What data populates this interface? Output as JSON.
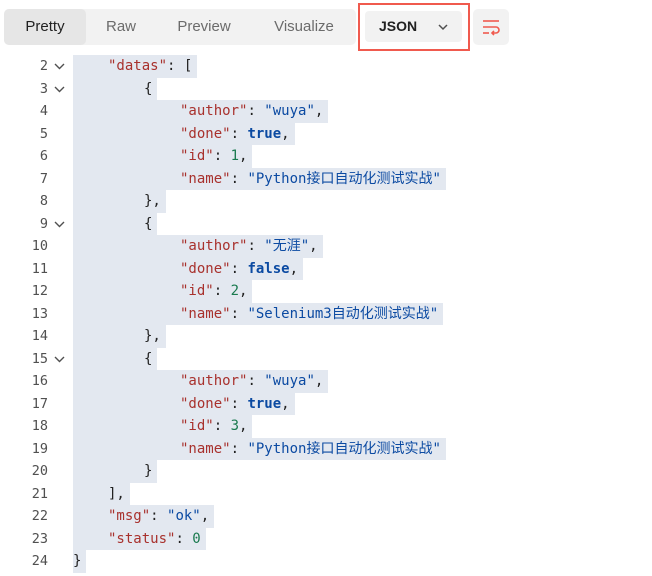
{
  "toolbar": {
    "tabs": [
      {
        "label": "Pretty",
        "active": true
      },
      {
        "label": "Raw",
        "active": false
      },
      {
        "label": "Preview",
        "active": false
      },
      {
        "label": "Visualize",
        "active": false
      }
    ],
    "format_select": {
      "value": "JSON",
      "icon": "chevron-down-icon"
    },
    "wrap_button": {
      "icon": "wrap-lines-icon"
    },
    "highlight_color": "#f05a4e"
  },
  "editor": {
    "lines": [
      {
        "num": "2",
        "fold": true,
        "indent": 1,
        "tokens": [
          {
            "t": "\"datas\"",
            "c": "k"
          },
          {
            "t": ": [",
            "c": "p"
          }
        ]
      },
      {
        "num": "3",
        "fold": true,
        "indent": 2,
        "tokens": [
          {
            "t": "{",
            "c": "p"
          }
        ]
      },
      {
        "num": "4",
        "fold": false,
        "indent": 3,
        "tokens": [
          {
            "t": "\"author\"",
            "c": "k"
          },
          {
            "t": ": ",
            "c": "p"
          },
          {
            "t": "\"wuya\"",
            "c": "s"
          },
          {
            "t": ",",
            "c": "p"
          }
        ]
      },
      {
        "num": "5",
        "fold": false,
        "indent": 3,
        "tokens": [
          {
            "t": "\"done\"",
            "c": "k"
          },
          {
            "t": ": ",
            "c": "p"
          },
          {
            "t": "true",
            "c": "b"
          },
          {
            "t": ",",
            "c": "p"
          }
        ]
      },
      {
        "num": "6",
        "fold": false,
        "indent": 3,
        "tokens": [
          {
            "t": "\"id\"",
            "c": "k"
          },
          {
            "t": ": ",
            "c": "p"
          },
          {
            "t": "1",
            "c": "n"
          },
          {
            "t": ",",
            "c": "p"
          }
        ]
      },
      {
        "num": "7",
        "fold": false,
        "indent": 3,
        "tokens": [
          {
            "t": "\"name\"",
            "c": "k"
          },
          {
            "t": ": ",
            "c": "p"
          },
          {
            "t": "\"Python接口自动化测试实战\"",
            "c": "s"
          }
        ]
      },
      {
        "num": "8",
        "fold": false,
        "indent": 2,
        "tokens": [
          {
            "t": "},",
            "c": "p"
          }
        ]
      },
      {
        "num": "9",
        "fold": true,
        "indent": 2,
        "tokens": [
          {
            "t": "{",
            "c": "p"
          }
        ]
      },
      {
        "num": "10",
        "fold": false,
        "indent": 3,
        "tokens": [
          {
            "t": "\"author\"",
            "c": "k"
          },
          {
            "t": ": ",
            "c": "p"
          },
          {
            "t": "\"无涯\"",
            "c": "s"
          },
          {
            "t": ",",
            "c": "p"
          }
        ]
      },
      {
        "num": "11",
        "fold": false,
        "indent": 3,
        "tokens": [
          {
            "t": "\"done\"",
            "c": "k"
          },
          {
            "t": ": ",
            "c": "p"
          },
          {
            "t": "false",
            "c": "b"
          },
          {
            "t": ",",
            "c": "p"
          }
        ]
      },
      {
        "num": "12",
        "fold": false,
        "indent": 3,
        "tokens": [
          {
            "t": "\"id\"",
            "c": "k"
          },
          {
            "t": ": ",
            "c": "p"
          },
          {
            "t": "2",
            "c": "n"
          },
          {
            "t": ",",
            "c": "p"
          }
        ]
      },
      {
        "num": "13",
        "fold": false,
        "indent": 3,
        "tokens": [
          {
            "t": "\"name\"",
            "c": "k"
          },
          {
            "t": ": ",
            "c": "p"
          },
          {
            "t": "\"Selenium3自动化测试实战\"",
            "c": "s"
          }
        ]
      },
      {
        "num": "14",
        "fold": false,
        "indent": 2,
        "tokens": [
          {
            "t": "},",
            "c": "p"
          }
        ]
      },
      {
        "num": "15",
        "fold": true,
        "indent": 2,
        "tokens": [
          {
            "t": "{",
            "c": "p"
          }
        ]
      },
      {
        "num": "16",
        "fold": false,
        "indent": 3,
        "tokens": [
          {
            "t": "\"author\"",
            "c": "k"
          },
          {
            "t": ": ",
            "c": "p"
          },
          {
            "t": "\"wuya\"",
            "c": "s"
          },
          {
            "t": ",",
            "c": "p"
          }
        ]
      },
      {
        "num": "17",
        "fold": false,
        "indent": 3,
        "tokens": [
          {
            "t": "\"done\"",
            "c": "k"
          },
          {
            "t": ": ",
            "c": "p"
          },
          {
            "t": "true",
            "c": "b"
          },
          {
            "t": ",",
            "c": "p"
          }
        ]
      },
      {
        "num": "18",
        "fold": false,
        "indent": 3,
        "tokens": [
          {
            "t": "\"id\"",
            "c": "k"
          },
          {
            "t": ": ",
            "c": "p"
          },
          {
            "t": "3",
            "c": "n"
          },
          {
            "t": ",",
            "c": "p"
          }
        ]
      },
      {
        "num": "19",
        "fold": false,
        "indent": 3,
        "tokens": [
          {
            "t": "\"name\"",
            "c": "k"
          },
          {
            "t": ": ",
            "c": "p"
          },
          {
            "t": "\"Python接口自动化测试实战\"",
            "c": "s"
          }
        ]
      },
      {
        "num": "20",
        "fold": false,
        "indent": 2,
        "tokens": [
          {
            "t": "}",
            "c": "p"
          }
        ]
      },
      {
        "num": "21",
        "fold": false,
        "indent": 1,
        "tokens": [
          {
            "t": "],",
            "c": "p"
          }
        ]
      },
      {
        "num": "22",
        "fold": false,
        "indent": 1,
        "tokens": [
          {
            "t": "\"msg\"",
            "c": "k"
          },
          {
            "t": ": ",
            "c": "p"
          },
          {
            "t": "\"ok\"",
            "c": "s"
          },
          {
            "t": ",",
            "c": "p"
          }
        ]
      },
      {
        "num": "23",
        "fold": false,
        "indent": 1,
        "tokens": [
          {
            "t": "\"status\"",
            "c": "k"
          },
          {
            "t": ": ",
            "c": "p"
          },
          {
            "t": "0",
            "c": "n"
          }
        ]
      },
      {
        "num": "24",
        "fold": false,
        "indent": 0,
        "tokens": [
          {
            "t": "}",
            "c": "p"
          }
        ]
      }
    ]
  }
}
